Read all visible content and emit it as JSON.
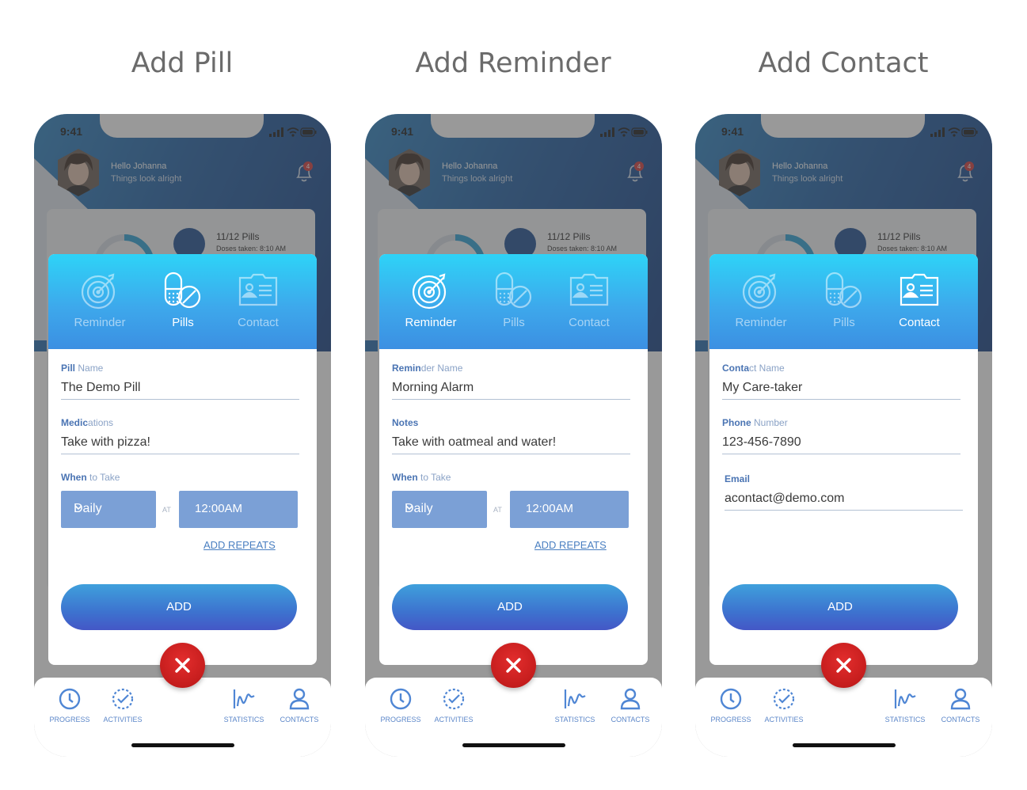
{
  "titles": [
    "Add Pill",
    "Add Reminder",
    "Add Contact"
  ],
  "status": {
    "time": "9:41"
  },
  "header": {
    "greeting": "Hello Johanna",
    "subtitle": "Things look alright",
    "notification_count": "4"
  },
  "dashboard": {
    "pills_count": "11/12 Pills",
    "doses_taken": "Doses taken: 8:10 AM"
  },
  "tabs": [
    "Reminder",
    "Pills",
    "Contact"
  ],
  "screens": [
    {
      "active_tab": "Pills",
      "fields": [
        {
          "label_bold": "Pill",
          "label_rest": " Name",
          "value": "The Demo Pill"
        },
        {
          "label_bold": "Medic",
          "label_rest": "ations",
          "value": "Take with pizza!"
        }
      ],
      "when": {
        "label_bold": "When",
        "label_rest": " to Take",
        "frequency": "Daily",
        "at": "AT",
        "time": "12:00AM",
        "add_repeats": "ADD REPEATS"
      },
      "add_label": "ADD"
    },
    {
      "active_tab": "Reminder",
      "fields": [
        {
          "label_bold": "Remin",
          "label_rest": "der Name",
          "value": "Morning Alarm"
        },
        {
          "label_bold": "Notes",
          "label_rest": "",
          "value": "Take with oatmeal and water!"
        }
      ],
      "when": {
        "label_bold": "When",
        "label_rest": " to Take",
        "frequency": "Daily",
        "at": "AT",
        "time": "12:00AM",
        "add_repeats": "ADD REPEATS"
      },
      "add_label": "ADD"
    },
    {
      "active_tab": "Contact",
      "fields": [
        {
          "label_bold": "Conta",
          "label_rest": "ct Name",
          "value": "My Care-taker"
        },
        {
          "label_bold": "Phone",
          "label_rest": " Number",
          "value": "123-456-7890"
        },
        {
          "label_bold": "Email",
          "label_rest": "",
          "value": "acontact@demo.com"
        }
      ],
      "add_label": "ADD"
    }
  ],
  "bottom_nav": [
    "PROGRESS",
    "ACTIVITIES",
    "STATISTICS",
    "CONTACTS"
  ],
  "colors": {
    "accent": "#3c8fe2",
    "header_gradient_top": "#2ed3f7",
    "close_red": "#c51d1d",
    "field_fill": "#7ba0d6"
  }
}
